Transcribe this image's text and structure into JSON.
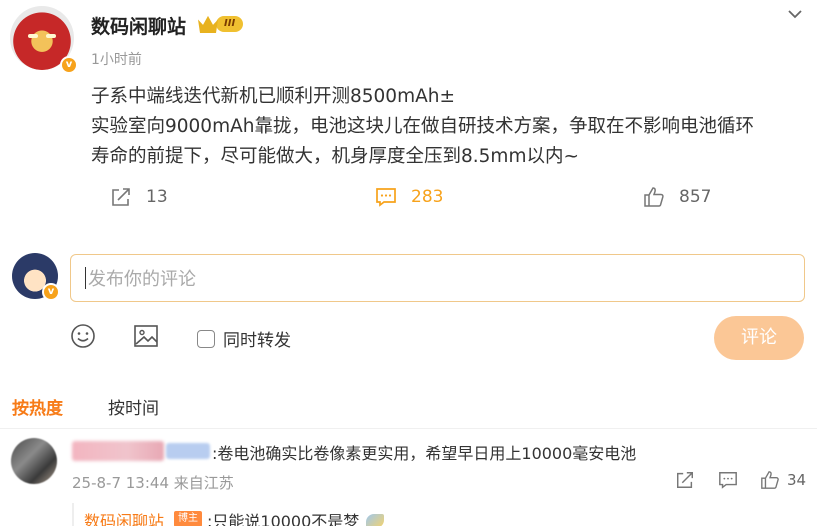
{
  "post": {
    "author": "数码闲聊站",
    "level": "III",
    "time": "1小时前",
    "lines": [
      "子系中端线迭代新机已顺利开测8500mAh±",
      "实验室向9000mAh靠拢，电池这块儿在做自研技术方案，争取在不影响电池循环",
      "寿命的前提下，尽可能做大，机身厚度全压到8.5mm以内~"
    ],
    "reposts": "13",
    "comments": "283",
    "likes": "857"
  },
  "composer": {
    "placeholder": "发布你的评论",
    "repost_label": "同时转发",
    "submit_label": "评论"
  },
  "tabs": {
    "hot": "按热度",
    "time": "按时间"
  },
  "comment": {
    "text": ":卷电池确实比卷像素更实用，希望早日用上10000毫安电池",
    "meta": "25-8-7 13:44 来自江苏",
    "likes": "34",
    "reply": {
      "author": "数码闲聊站",
      "badge": "博主",
      "text": ":只能说10000不是梦"
    }
  },
  "colors": {
    "accent": "#f77b17",
    "comment_active": "#f7a21b",
    "submit_bg": "#fbc796",
    "verified": "#f7a21b"
  }
}
